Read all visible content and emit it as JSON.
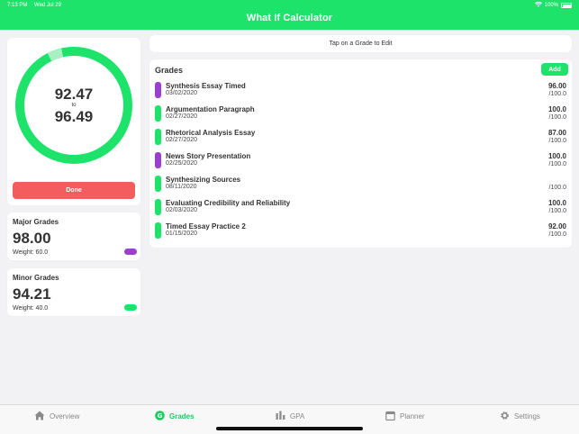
{
  "status": {
    "time": "7:13 PM",
    "date": "Wed Jul 29",
    "battery": "100%"
  },
  "app": {
    "title": "What If Calculator"
  },
  "colors": {
    "accent": "#1ee36a",
    "danger": "#f45d5d",
    "major": "#9b3fcf",
    "minor": "#1ee36a"
  },
  "ring": {
    "low": "92.47",
    "to": "to",
    "high": "96.49",
    "progress": 0.965,
    "range_start": 0.925
  },
  "done_label": "Done",
  "major": {
    "title": "Major Grades",
    "value": "98.00",
    "weight": "Weight: 60.0"
  },
  "minor": {
    "title": "Minor Grades",
    "value": "94.21",
    "weight": "Weight: 40.0"
  },
  "tap_hint": "Tap on a Grade to Edit",
  "grades": {
    "title": "Grades",
    "add_label": "Add",
    "items": [
      {
        "name": "Synthesis Essay Timed",
        "date": "03/02/2020",
        "score": "96.00",
        "max": "/100.0",
        "type": "major"
      },
      {
        "name": "Argumentation Paragraph",
        "date": "02/27/2020",
        "score": "100.0",
        "max": "/100.0",
        "type": "minor"
      },
      {
        "name": "Rhetorical Analysis Essay",
        "date": "02/27/2020",
        "score": "87.00",
        "max": "/100.0",
        "type": "minor"
      },
      {
        "name": "News Story Presentation",
        "date": "02/25/2020",
        "score": "100.0",
        "max": "/100.0",
        "type": "major"
      },
      {
        "name": "Synthesizing Sources",
        "date": "08/11/2020",
        "score": "",
        "max": "/100.0",
        "type": "minor"
      },
      {
        "name": "Evaluating Credibility and Reliability",
        "date": "02/03/2020",
        "score": "100.0",
        "max": "/100.0",
        "type": "minor"
      },
      {
        "name": "Timed Essay Practice 2",
        "date": "01/15/2020",
        "score": "92.00",
        "max": "/100.0",
        "type": "minor"
      }
    ]
  },
  "tabs": [
    {
      "label": "Overview",
      "icon": "home-icon",
      "active": false
    },
    {
      "label": "Grades",
      "icon": "grades-icon",
      "active": true
    },
    {
      "label": "GPA",
      "icon": "bar-chart-icon",
      "active": false
    },
    {
      "label": "Planner",
      "icon": "calendar-icon",
      "active": false
    },
    {
      "label": "Settings",
      "icon": "gear-icon",
      "active": false
    }
  ]
}
